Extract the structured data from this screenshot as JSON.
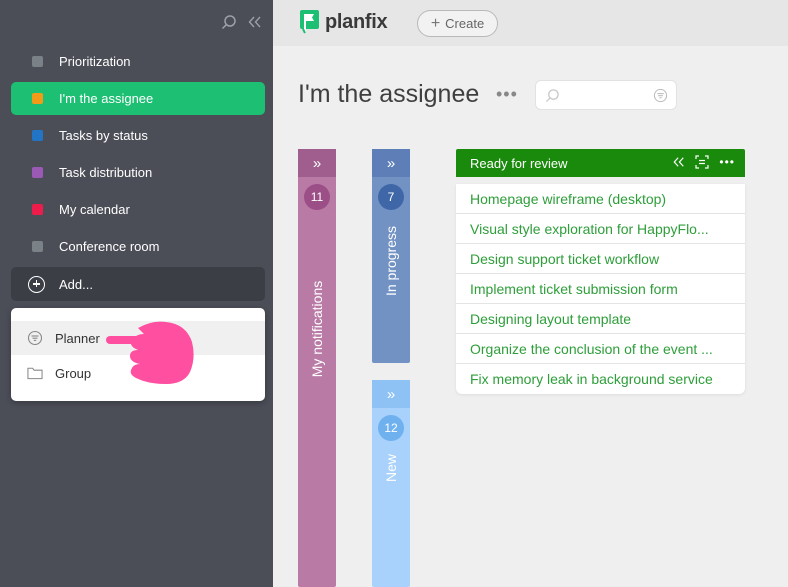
{
  "colors": {
    "sidebar_bg": "#4b4d57",
    "active_item": "#1dbf73",
    "brand_green": "#1a8a0d",
    "card_text": "#2e9e3a",
    "hand": "#ff4fa0"
  },
  "sidebar": {
    "items": [
      {
        "label": "Prioritization",
        "color": "#7a8288"
      },
      {
        "label": "I'm the assignee",
        "color": "#f39a18",
        "active": true
      },
      {
        "label": "Tasks by status",
        "color": "#2275c4"
      },
      {
        "label": "Task distribution",
        "color": "#9b59b6"
      },
      {
        "label": "My calendar",
        "color": "#ee1c4a"
      },
      {
        "label": "Conference room",
        "color": "#7a8288"
      }
    ],
    "add_label": "Add..."
  },
  "popup": {
    "items": [
      {
        "label": "Planner",
        "icon": "filter-icon"
      },
      {
        "label": "Group",
        "icon": "folder-icon"
      }
    ]
  },
  "header": {
    "logo_text": "planfix",
    "create_label": "Create"
  },
  "main": {
    "title": "I'm the assignee",
    "search_placeholder": ""
  },
  "columns": [
    {
      "label": "My notifications",
      "count": "11",
      "color": "#b97aa5",
      "badge": "#9b4f86"
    },
    {
      "label": "In progress",
      "count": "7",
      "color": "#7292c4",
      "badge": "#3f67a8"
    },
    {
      "label": "New",
      "count": "12",
      "color": "#a8d1fb",
      "badge": "#6fb1ef"
    }
  ],
  "review": {
    "title": "Ready for review",
    "cards": [
      "Homepage wireframe (desktop)",
      "Visual style exploration for HappyFlo...",
      "Design support ticket workflow",
      "Implement ticket submission form",
      "Designing layout template",
      "Organize the conclusion of the event ...",
      "Fix memory leak in background service"
    ]
  }
}
